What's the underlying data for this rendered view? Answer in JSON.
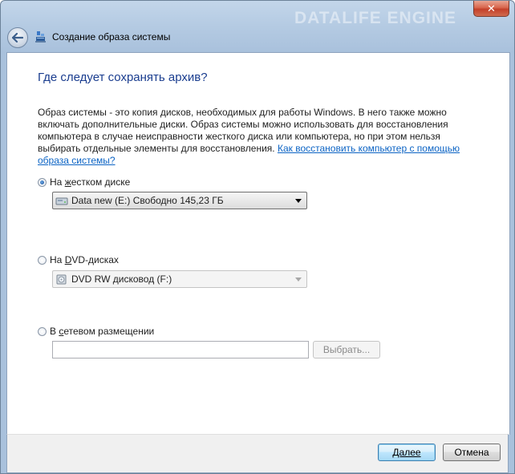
{
  "window": {
    "title": "Создание образа системы",
    "watermark": "DATALIFE ENGINE",
    "close_label": "✕"
  },
  "content": {
    "heading": "Где следует сохранять архив?",
    "description": "Образ системы - это копия дисков, необходимых для работы Windows. В него также можно включать дополнительные диски. Образ системы можно использовать для восстановления компьютера в случае неисправности жесткого диска или компьютера, но при этом нельзя выбирать отдельные элементы для восстановления.",
    "help_link": "Как восстановить компьютер с помощью образа системы?"
  },
  "options": {
    "hard_disk": {
      "label_prefix": "На ",
      "label_underlined": "ж",
      "label_suffix": "естком диске",
      "selected": true,
      "combo_value": "Data new (E:)  Свободно 145,23 ГБ"
    },
    "dvd": {
      "label_prefix": "На ",
      "label_underlined": "D",
      "label_suffix": "VD-дисках",
      "selected": false,
      "combo_value": "DVD RW дисковод (F:)"
    },
    "network": {
      "label_prefix": "В ",
      "label_underlined": "с",
      "label_suffix": "етевом размещении",
      "selected": false,
      "path_value": "",
      "browse_label": "Выбрать..."
    }
  },
  "footer": {
    "next_label": "Далее",
    "cancel_label": "Отмена"
  },
  "colors": {
    "heading": "#1a3d8f",
    "link": "#0b63c4",
    "titlebar": "#b5cbe3"
  }
}
